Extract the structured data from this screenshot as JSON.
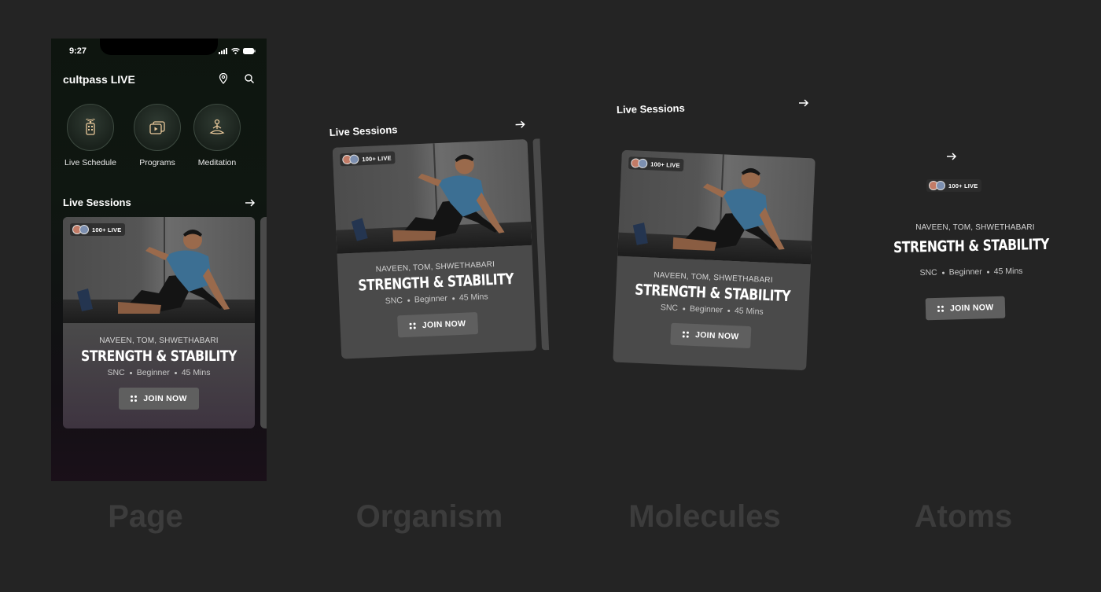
{
  "phone": {
    "status_time": "9:27",
    "app_title": "cultpass LIVE",
    "categories": [
      {
        "label": "Live Schedule",
        "icon": "live-schedule-icon"
      },
      {
        "label": "Programs",
        "icon": "programs-icon"
      },
      {
        "label": "Meditation",
        "icon": "meditation-icon"
      }
    ]
  },
  "section": {
    "title": "Live Sessions"
  },
  "card": {
    "badge": "100+ LIVE",
    "trainers": "NAVEEN, TOM, SHWETHABARI",
    "title": "STRENGTH & STABILITY",
    "meta": [
      "SNC",
      "Beginner",
      "45 Mins"
    ],
    "cta": "JOIN NOW"
  },
  "captions": {
    "page": "Page",
    "organism": "Organism",
    "molecules": "Molecules",
    "atoms": "Atoms"
  },
  "colors": {
    "background": "#242424",
    "card": "#4a4a4a",
    "button": "#5f5f5f",
    "caption": "#3c3c3c"
  }
}
